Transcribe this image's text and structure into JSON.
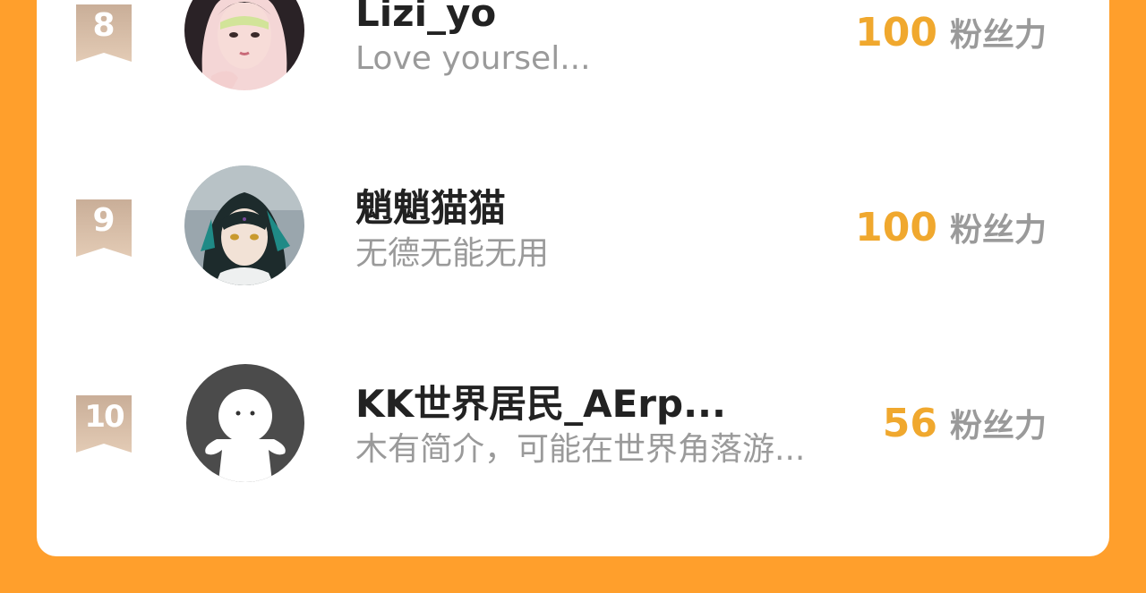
{
  "colors": {
    "background": "#FF9F2C",
    "card": "#FFFFFF",
    "score": "#F0A82E",
    "badge": "#D9BBA0",
    "name": "#222222",
    "bio": "#9A9A9A"
  },
  "leaderboard": {
    "entries": [
      {
        "rank": "8",
        "name": "Lizi_yo",
        "bio": "Love yoursel...",
        "score": "100",
        "score_unit": "粉丝力",
        "avatar_icon": "girl-portrait-avatar-icon"
      },
      {
        "rank": "9",
        "name": "魈魈猫猫",
        "bio": "无德无能无用",
        "score": "100",
        "score_unit": "粉丝力",
        "avatar_icon": "anime-boy-avatar-icon"
      },
      {
        "rank": "10",
        "name": "KK世界居民_AErp...",
        "bio": "木有简介，可能在世界角落游...",
        "score": "56",
        "score_unit": "粉丝力",
        "avatar_icon": "default-user-avatar-icon"
      }
    ]
  }
}
